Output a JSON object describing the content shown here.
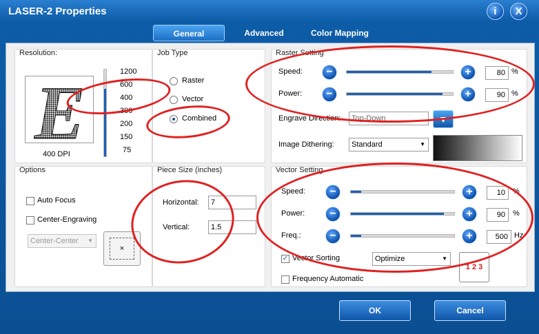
{
  "window": {
    "title": "LASER-2 Properties",
    "help_glyph": "i",
    "close_glyph": "X"
  },
  "tabs": [
    "General",
    "Advanced",
    "Color Mapping"
  ],
  "resolution": {
    "title": "Resolution:",
    "preview_letter": "E",
    "dpi_label": "400 DPI",
    "ticks": [
      "1200",
      "600",
      "400",
      "300",
      "200",
      "150",
      "75"
    ],
    "selected": "400"
  },
  "job_type": {
    "title": "Job Type",
    "options": [
      "Raster",
      "Vector",
      "Combined"
    ],
    "selected": "Combined"
  },
  "raster": {
    "title": "Raster Setting",
    "speed_label": "Speed:",
    "speed_value": "80",
    "speed_unit": "%",
    "power_label": "Power:",
    "power_value": "90",
    "power_unit": "%",
    "engrave_label": "Engrave Direction:",
    "engrave_value": "Top-Down",
    "dither_label": "Image Dithering:",
    "dither_value": "Standard"
  },
  "options": {
    "title": "Options",
    "auto_focus": "Auto Focus",
    "center_engraving": "Center-Engraving",
    "center_select": "Center-Center",
    "center_glyph": "×"
  },
  "piece_size": {
    "title": "Piece Size (inches)",
    "horizontal_label": "Horizontal:",
    "horizontal_value": "7",
    "vertical_label": "Vertical:",
    "vertical_value": "1.5"
  },
  "vector": {
    "title": "Vector Setting",
    "speed_label": "Speed:",
    "speed_value": "10",
    "speed_unit": "%",
    "power_label": "Power:",
    "power_value": "90",
    "power_unit": "%",
    "freq_label": "Freq.:",
    "freq_value": "500",
    "freq_unit": "Hz",
    "sorting_label": "Vector Sorting",
    "sorting_value": "Optimize",
    "freq_auto_label": "Frequency Automatic"
  },
  "levels": {
    "raster_speed": 0.8,
    "raster_power": 0.9,
    "vector_speed": 0.1,
    "vector_power": 0.9,
    "vector_freq": 0.1
  },
  "buttons": {
    "ok": "OK",
    "cancel": "Cancel"
  },
  "glyphs": {
    "minus": "−",
    "plus": "+",
    "dropdown": "▼",
    "sort_icon": "1 2 3"
  },
  "colors": {
    "accent": "#1c5fb5",
    "annotation": "#e02020",
    "frame": "#0b4f92"
  }
}
